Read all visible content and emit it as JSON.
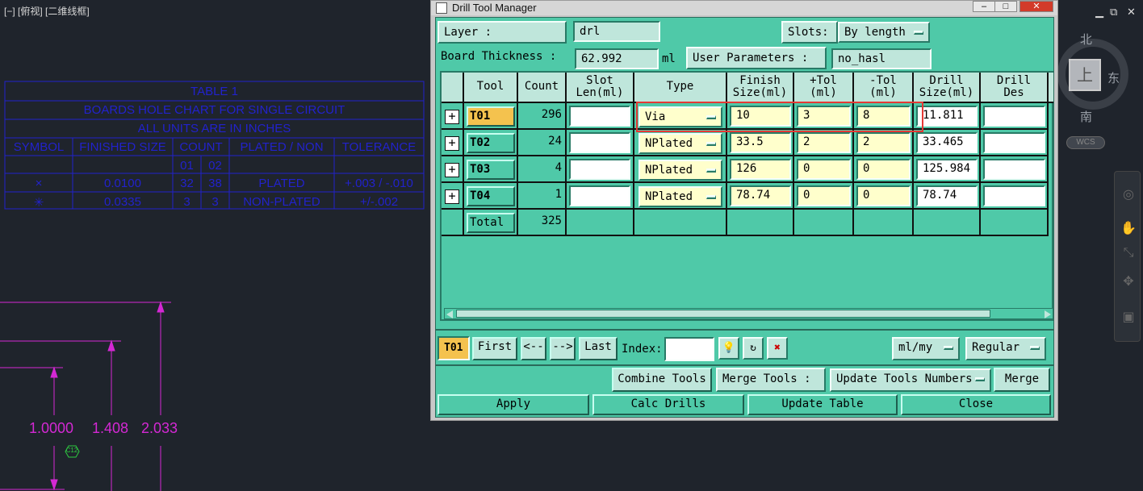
{
  "cad": {
    "viewport_label": "[−] [俯视] [二维线框]",
    "table": {
      "title": "TABLE 1",
      "subtitle": "BOARDS HOLE CHART FOR SINGLE CIRCUIT",
      "units": "ALL UNITS ARE IN INCHES",
      "headers": [
        "SYMBOL",
        "FINISHED SIZE",
        "COUNT",
        "PLATED / NON",
        "TOLERANCE"
      ],
      "count_subheaders": [
        "01",
        "02"
      ],
      "rows": [
        {
          "symbol": "×",
          "size": "0.0100",
          "c1": "32",
          "c2": "38",
          "plated": "PLATED",
          "tol": "+.003 / -.010"
        },
        {
          "symbol": "✳",
          "size": "0.0335",
          "c1": "3",
          "c2": "3",
          "plated": "NON-PLATED",
          "tol": "+/-.002"
        }
      ]
    },
    "dims": [
      "1.0000",
      "1.408",
      "2.033"
    ],
    "marker": "C12",
    "compass": {
      "north": "北",
      "east": "东",
      "south": "南",
      "top": "上",
      "wcs": "WCS"
    }
  },
  "window": {
    "title": "Drill Tool Manager",
    "layer_label": "Layer          :",
    "layer_value": "drl",
    "slots_label": "Slots:",
    "slots_value": "By length",
    "thickness_label": "Board Thickness :",
    "thickness_value": "62.992",
    "thickness_unit": "ml",
    "user_params_label": "User Parameters :",
    "user_params_value": "no_hasl",
    "columns": {
      "tool": "Tool",
      "count": "Count",
      "slot1": "Slot",
      "slot2": "Len(ml)",
      "type": "Type",
      "finish1": "Finish",
      "finish2": "Size(ml)",
      "ptol1": "+Tol",
      "ptol2": "(ml)",
      "mtol1": "-Tol",
      "mtol2": "(ml)",
      "drill1": "Drill",
      "drill2": "Size(ml)",
      "des1": "Drill",
      "des2": "Des"
    },
    "tools": [
      {
        "name": "T01",
        "count": "296",
        "slot": "",
        "type": "Via",
        "finish": "10",
        "ptol": "3",
        "mtol": "8",
        "drill": "11.811",
        "des": ""
      },
      {
        "name": "T02",
        "count": "24",
        "slot": "",
        "type": "NPlated",
        "finish": "33.5",
        "ptol": "2",
        "mtol": "2",
        "drill": "33.465",
        "des": ""
      },
      {
        "name": "T03",
        "count": "4",
        "slot": "",
        "type": "NPlated",
        "finish": "126",
        "ptol": "0",
        "mtol": "0",
        "drill": "125.984",
        "des": ""
      },
      {
        "name": "T04",
        "count": "1",
        "slot": "",
        "type": "NPlated",
        "finish": "78.74",
        "ptol": "0",
        "mtol": "0",
        "drill": "78.74",
        "des": ""
      }
    ],
    "total_label": "Total",
    "total_count": "325",
    "nav": {
      "current": "T01",
      "first": "First",
      "prev": "<--",
      "next": "-->",
      "last": "Last",
      "index_label": "Index:",
      "index_value": "",
      "units": "ml/my",
      "mode": "Regular"
    },
    "combine_label": "Combine Tools",
    "merge_label": "Merge Tools :",
    "update_numbers": "Update Tools Numbers",
    "merge_button": "Merge",
    "apply": "Apply",
    "calc": "Calc Drills",
    "update_table": "Update Table",
    "close": "Close"
  },
  "colors": {
    "panel": "#4fc9a8",
    "selected_tool": "#f4c24e",
    "highlight": "#e53935"
  }
}
